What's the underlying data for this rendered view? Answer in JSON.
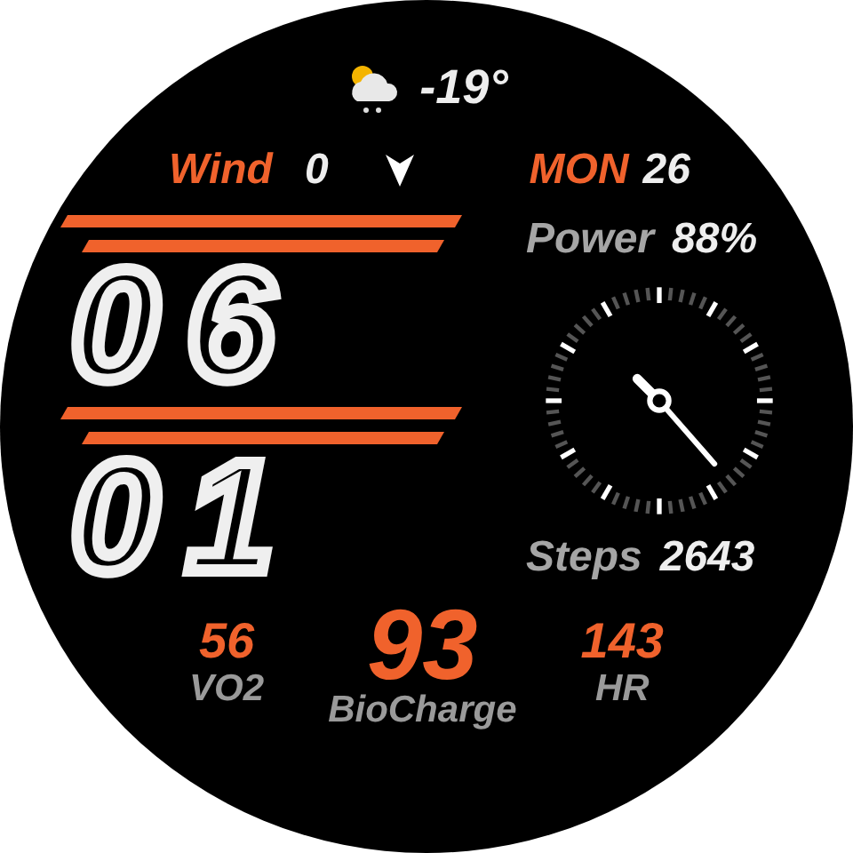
{
  "weather": {
    "temperature": "-19°"
  },
  "wind": {
    "label": "Wind",
    "value": "0"
  },
  "date": {
    "day": "MON",
    "date": "26"
  },
  "time": {
    "hours": "06",
    "minutes": "01"
  },
  "power": {
    "label": "Power",
    "value": "88%"
  },
  "steps": {
    "label": "Steps",
    "value": "2643"
  },
  "metrics": [
    {
      "value": "56",
      "label": "VO2",
      "kind": "small"
    },
    {
      "value": "93",
      "label": "BioCharge",
      "kind": "large"
    },
    {
      "value": "143",
      "label": "HR",
      "kind": "small"
    }
  ]
}
